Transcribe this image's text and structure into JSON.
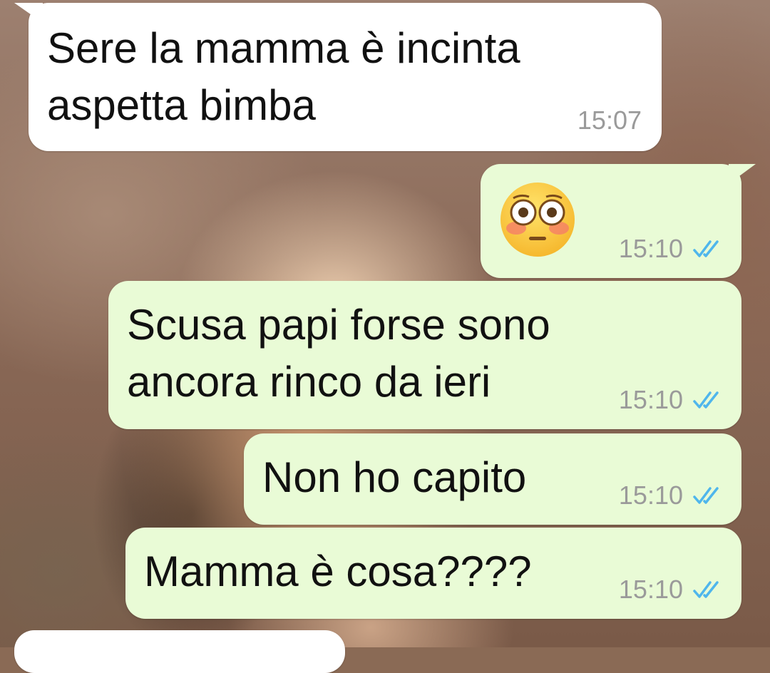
{
  "chat": {
    "messages": [
      {
        "direction": "incoming",
        "text": "Sere la mamma è incinta\naspetta bimba",
        "time": "15:07"
      },
      {
        "direction": "outgoing",
        "emoji": "flushed-face",
        "time": "15:10",
        "status": "read"
      },
      {
        "direction": "outgoing",
        "text": "Scusa papi forse sono\nancora rinco da ieri",
        "time": "15:10",
        "status": "read"
      },
      {
        "direction": "outgoing",
        "text": "Non ho capito",
        "time": "15:10",
        "status": "read"
      },
      {
        "direction": "outgoing",
        "text": "Mamma è cosa????",
        "time": "15:10",
        "status": "read"
      }
    ]
  },
  "colors": {
    "incoming_bubble": "#ffffff",
    "outgoing_bubble": "#e9fbd6",
    "read_ticks": "#4fb6ec",
    "timestamp": "#9a9a9a"
  }
}
